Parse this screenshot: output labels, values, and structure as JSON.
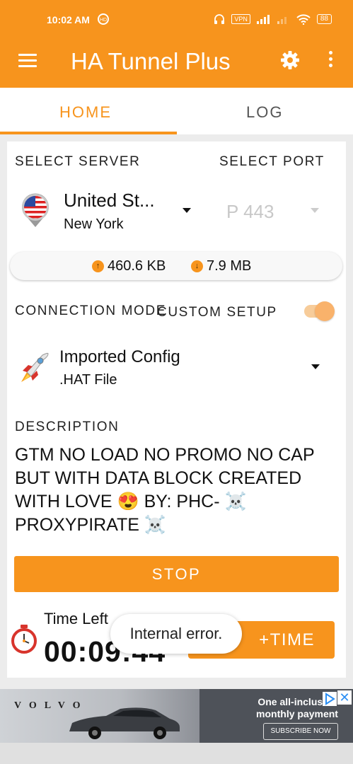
{
  "status_bar": {
    "time": "10:02 AM",
    "hd_badge": "HD",
    "vpn": "VPN",
    "battery": "88"
  },
  "app_bar": {
    "title": "HA Tunnel Plus"
  },
  "tabs": [
    {
      "label": "HOME"
    },
    {
      "label": "LOG"
    }
  ],
  "server": {
    "section_label": "SELECT SERVER",
    "name": "United St...",
    "city": "New York"
  },
  "port": {
    "section_label": "SELECT PORT",
    "value": "P 443"
  },
  "usage": {
    "upload": "460.6 KB",
    "download": "7.9 MB"
  },
  "connection": {
    "mode_label": "CONNECTION MODE",
    "custom_label": "CUSTOM SETUP",
    "custom_enabled": true,
    "config_name": "Imported Config",
    "config_type": ".HAT File"
  },
  "description": {
    "label": "DESCRIPTION",
    "line1": "GTM NO LOAD NO PROMO NO CAP",
    "line2": "BUT WITH DATA BLOCK CREATED",
    "line3_a": "WITH LOVE",
    "emoji_love": "😍",
    "line3_b": "BY: PHC-",
    "emoji_skull": "☠️",
    "line4": "PROXYPIRATE"
  },
  "actions": {
    "stop_label": "STOP",
    "add_time_label": "+TIME"
  },
  "timer": {
    "label": "Time Left",
    "value": "00:09:44"
  },
  "toast": {
    "message": "Internal error."
  },
  "ad": {
    "brand": "VOLVO",
    "headline": "One all-inclusive monthly payment",
    "cta": "SUBSCRIBE NOW",
    "close": "✕"
  },
  "colors": {
    "accent": "#f7941d"
  }
}
